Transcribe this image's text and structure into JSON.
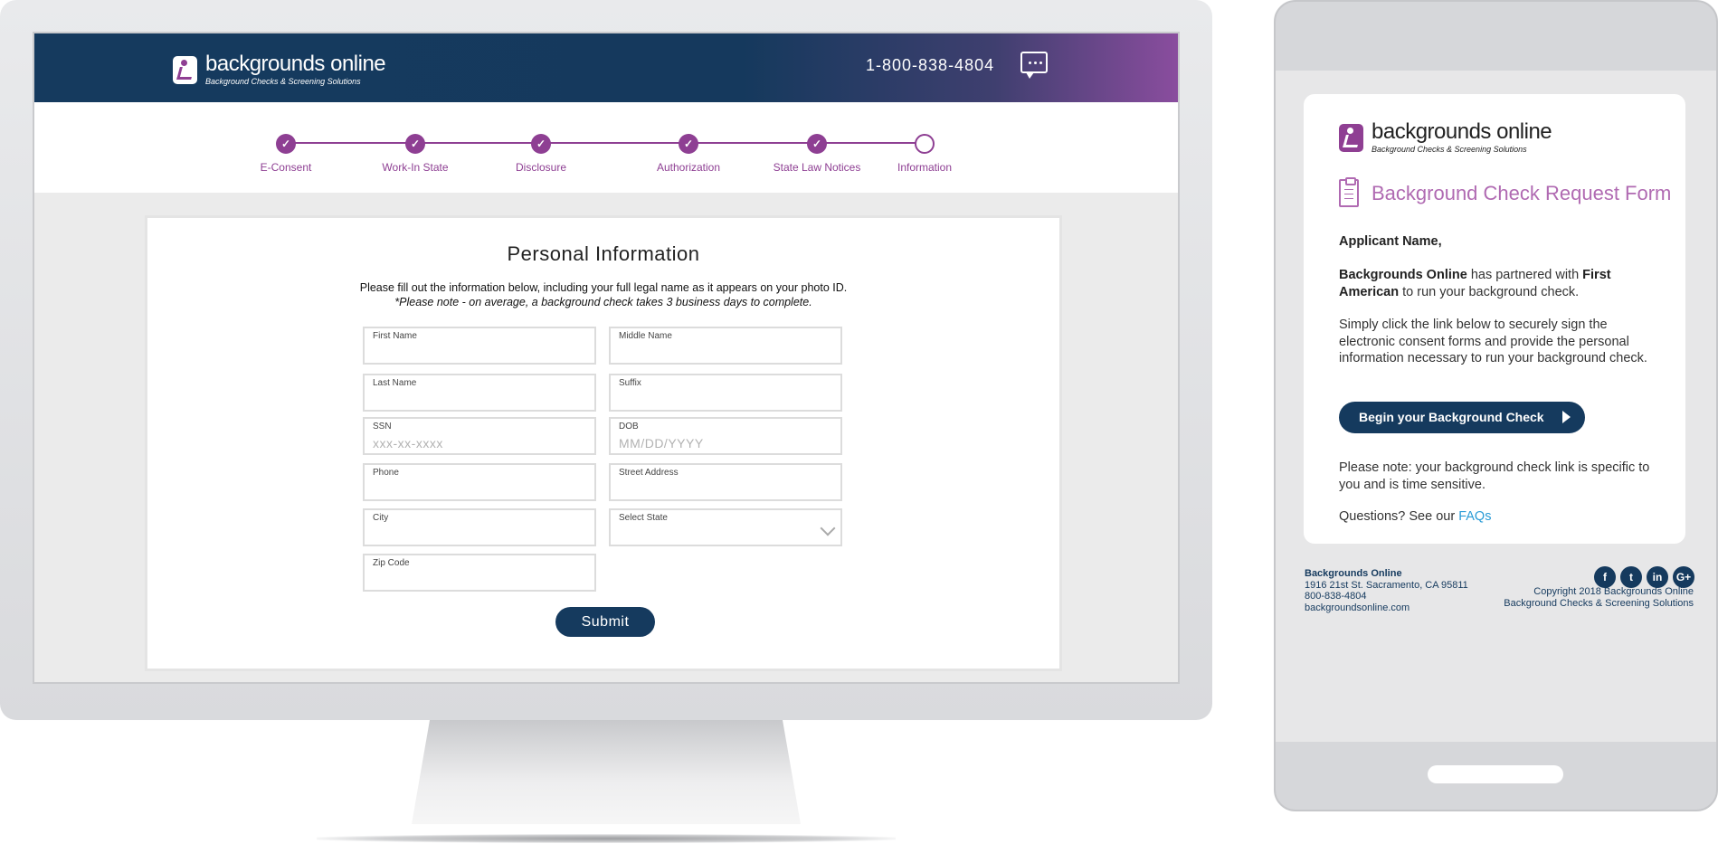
{
  "desktop": {
    "header": {
      "brand_name": "backgrounds online",
      "brand_tagline": "Background Checks & Screening Solutions",
      "phone": "1-800-838-4804",
      "chat_icon": "chat-bubble-icon"
    },
    "steps": [
      {
        "label": "E-Consent",
        "state": "done"
      },
      {
        "label": "Work-In State",
        "state": "done"
      },
      {
        "label": "Disclosure",
        "state": "done"
      },
      {
        "label": "Authorization",
        "state": "done"
      },
      {
        "label": "State Law Notices",
        "state": "done"
      },
      {
        "label": "Information",
        "state": "current"
      }
    ],
    "form": {
      "title": "Personal Information",
      "instruction": "Please fill out the information below, including your full legal name as it appears on your photo ID.",
      "note": "*Please note - on average, a background check takes 3 business days to complete.",
      "fields": {
        "first_name": {
          "label": "First Name",
          "placeholder": ""
        },
        "middle_name": {
          "label": "Middle Name",
          "placeholder": ""
        },
        "last_name": {
          "label": "Last Name",
          "placeholder": ""
        },
        "suffix": {
          "label": "Suffix",
          "placeholder": ""
        },
        "ssn": {
          "label": "SSN",
          "placeholder": "xxx-xx-xxxx"
        },
        "dob": {
          "label": "DOB",
          "placeholder": "MM/DD/YYYY"
        },
        "phone": {
          "label": "Phone",
          "placeholder": ""
        },
        "street": {
          "label": "Street Address",
          "placeholder": ""
        },
        "city": {
          "label": "City",
          "placeholder": ""
        },
        "state": {
          "label": "Select State",
          "placeholder": ""
        },
        "zip": {
          "label": "Zip Code",
          "placeholder": ""
        }
      },
      "submit_label": "Submit"
    }
  },
  "mobile": {
    "brand_name": "backgrounds online",
    "brand_tagline": "Background Checks & Screening Solutions",
    "form_title": "Background Check Request Form",
    "greeting": "Applicant Name,",
    "partner_bold_1": "Backgrounds Online",
    "partner_mid": " has partnered with ",
    "partner_bold_2": "First American",
    "partner_end": " to run your background check.",
    "instruction": "Simply click the link below to securely sign the electronic consent forms and provide the personal information necessary to run your background check.",
    "button_label": "Begin your Background Check",
    "note": "Please note: your background check link is specific to you and is time sensitive.",
    "questions": "Questions? See our ",
    "faq_link": "FAQs",
    "footer": {
      "company": "Backgrounds Online",
      "address": "1916 21st St. Sacramento, CA 95811",
      "phone": "800-838-4804",
      "website": "backgroundsonline.com",
      "copyright": "Copyright 2018 Backgrounds Online",
      "tagline": "Background Checks & Screening Solutions"
    },
    "social": [
      "f",
      "t",
      "in",
      "G+"
    ]
  },
  "colors": {
    "navy": "#153a5e",
    "purple": "#8e3f93",
    "link_blue": "#2a9bd6"
  }
}
